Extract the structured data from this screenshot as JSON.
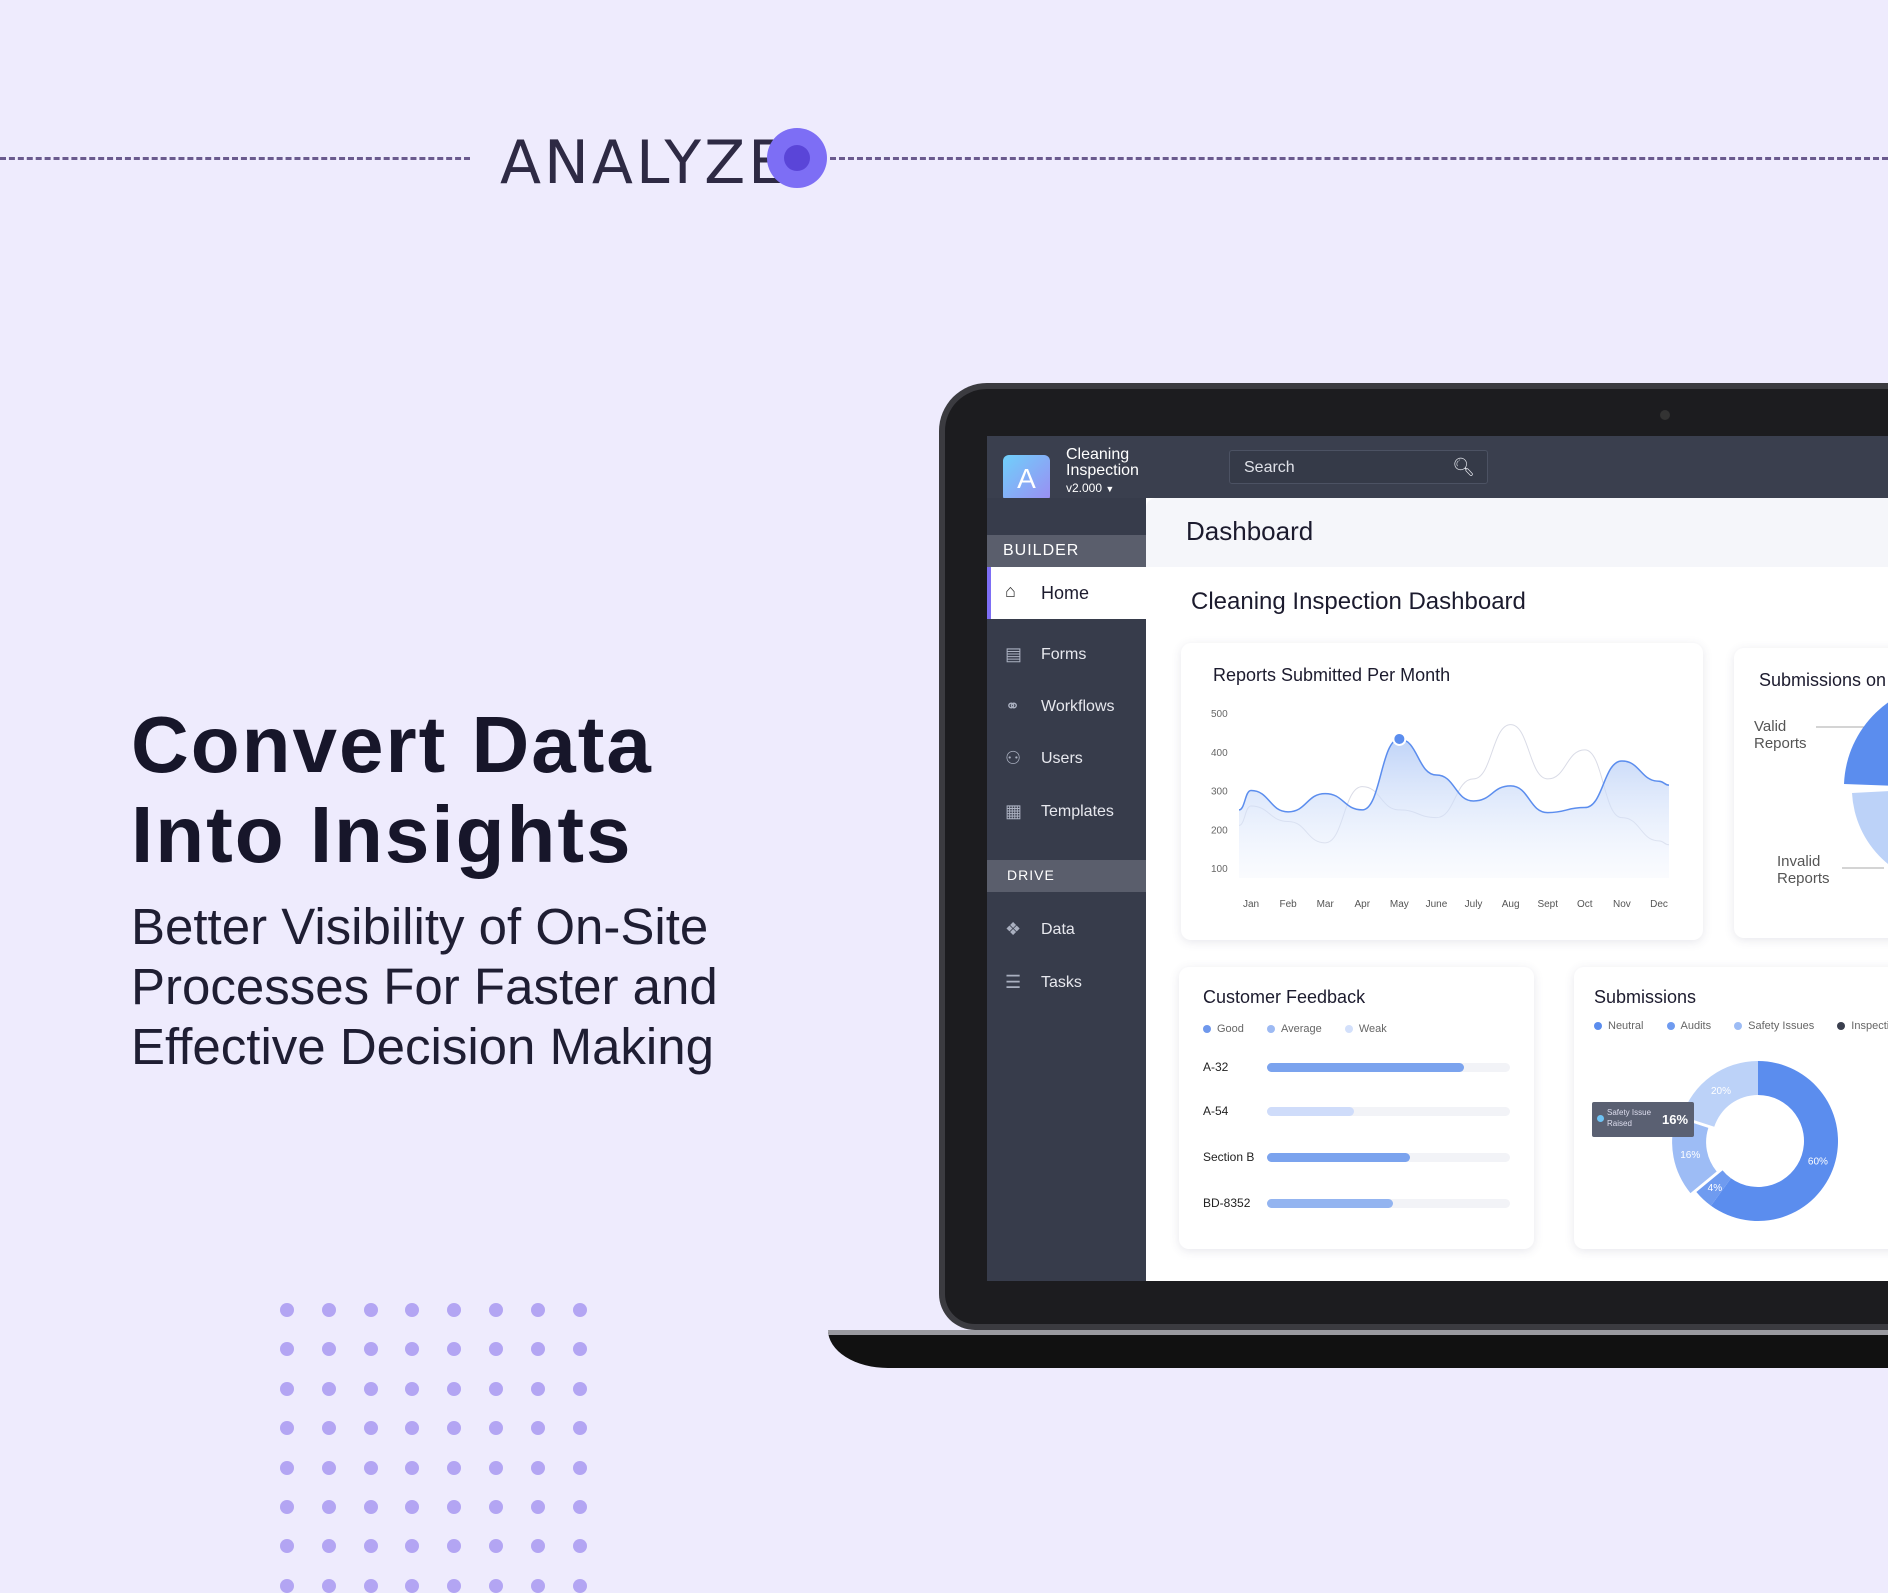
{
  "banner": {
    "label": "ANALYZE",
    "accent": "#7d6ef5"
  },
  "hero": {
    "headline_lines": [
      "Convert Data",
      "Into Insights"
    ],
    "sub_lines": [
      "Better Visibility of On-Site",
      "Processes For Faster and",
      "Effective Decision Making"
    ]
  },
  "app": {
    "logo_letter": "A",
    "title_line1": "Cleaning",
    "title_line2": "Inspection",
    "version": "v2.000",
    "search_placeholder": "Search"
  },
  "sidebar": {
    "builder_label": "BUILDER",
    "drive_label": "DRIVE",
    "items": [
      {
        "label": "Home",
        "icon": "home-icon",
        "active": true
      },
      {
        "label": "Forms",
        "icon": "forms-icon"
      },
      {
        "label": "Workflows",
        "icon": "workflows-icon"
      },
      {
        "label": "Users",
        "icon": "users-icon"
      },
      {
        "label": "Templates",
        "icon": "templates-icon"
      }
    ],
    "drive_items": [
      {
        "label": "Data",
        "icon": "data-icon"
      },
      {
        "label": "Tasks",
        "icon": "tasks-icon"
      }
    ]
  },
  "page": {
    "header": "Dashboard",
    "title": "Cleaning Inspection Dashboard"
  },
  "chart_data": [
    {
      "type": "area",
      "title": "Reports Submitted Per Month",
      "categories": [
        "Jan",
        "Feb",
        "Mar",
        "Apr",
        "May",
        "June",
        "July",
        "Aug",
        "Sept",
        "Oct",
        "Nov",
        "Dec"
      ],
      "yticks": [
        500,
        400,
        300,
        200,
        100
      ],
      "ylim": [
        50,
        520
      ],
      "series": [
        {
          "values": [
            300,
            245,
            292,
            250,
            433,
            340,
            273,
            312,
            243,
            256,
            376,
            324
          ],
          "color": "#5b8dee",
          "highlight_index": 4
        },
        {
          "values": [
            260,
            220,
            165,
            310,
            250,
            230,
            330,
            470,
            330,
            405,
            230,
            170
          ],
          "color": "#d9dbe6"
        }
      ]
    },
    {
      "type": "pie",
      "title": "Submissions on",
      "labels": [
        "Valid Reports",
        "Invalid Reports"
      ]
    },
    {
      "type": "bar",
      "title": "Customer Feedback",
      "legend": [
        {
          "name": "Good",
          "color": "#6f98ec"
        },
        {
          "name": "Average",
          "color": "#9dbaf3"
        },
        {
          "name": "Weak",
          "color": "#d3e0fb"
        }
      ],
      "categories": [
        "A-32",
        "A-54",
        "Section B",
        "BD-8352"
      ],
      "values": [
        81,
        36,
        59,
        52
      ],
      "colors": [
        "#7ba3ee",
        "#cfdcfa",
        "#7ba3ee",
        "#93b4f0"
      ],
      "xlim": [
        0,
        100
      ]
    },
    {
      "type": "pie",
      "title": "Submissions",
      "legend": [
        {
          "name": "Neutral",
          "color": "#5b8dee"
        },
        {
          "name": "Audits",
          "color": "#6f9bf0"
        },
        {
          "name": "Safety Issues",
          "color": "#9dbcf5"
        },
        {
          "name": "Inspecti",
          "color": "#3a3f4e"
        }
      ],
      "slices": [
        {
          "value": 60,
          "label": "60%",
          "color": "#5b8dee"
        },
        {
          "value": 4,
          "label": "4%",
          "color": "#6f9bf0"
        },
        {
          "value": 16,
          "label": "16%",
          "color": "#9dbcf5"
        },
        {
          "value": 20,
          "label": "20%",
          "color": "#bcd2f8"
        }
      ],
      "tooltip": {
        "label_line1": "Safety Issue",
        "label_line2": "Raised",
        "value": "16%"
      }
    }
  ]
}
